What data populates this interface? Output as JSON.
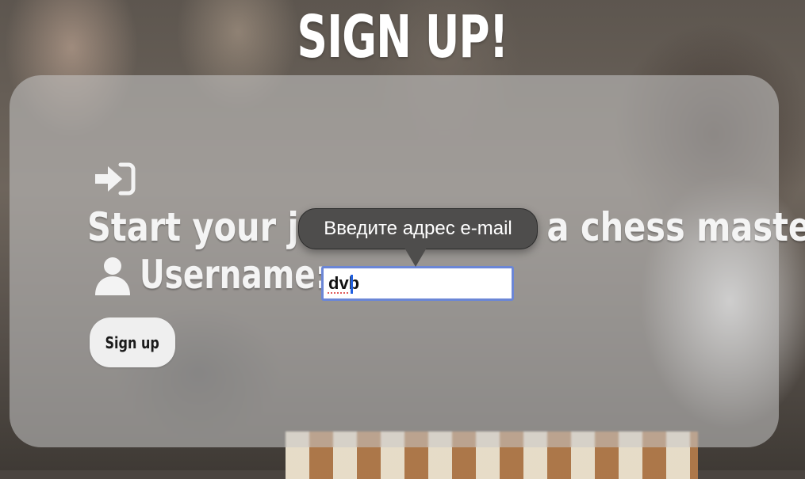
{
  "page": {
    "title": "SIGN UP!"
  },
  "form": {
    "heading": "Start your journey to be a chess master",
    "username_label": "Username:",
    "username_value": "dvb",
    "submit_label": "Sign up"
  },
  "tooltip": {
    "text": "Введите адрес e-mail"
  },
  "icons": {
    "login": "sign-in-icon",
    "user": "user-icon"
  },
  "colors": {
    "panel": "#c8c8c8",
    "input_focus_border": "#6b86d6",
    "button_bg": "#efefef",
    "tooltip_bg": "#4e4d4c"
  }
}
